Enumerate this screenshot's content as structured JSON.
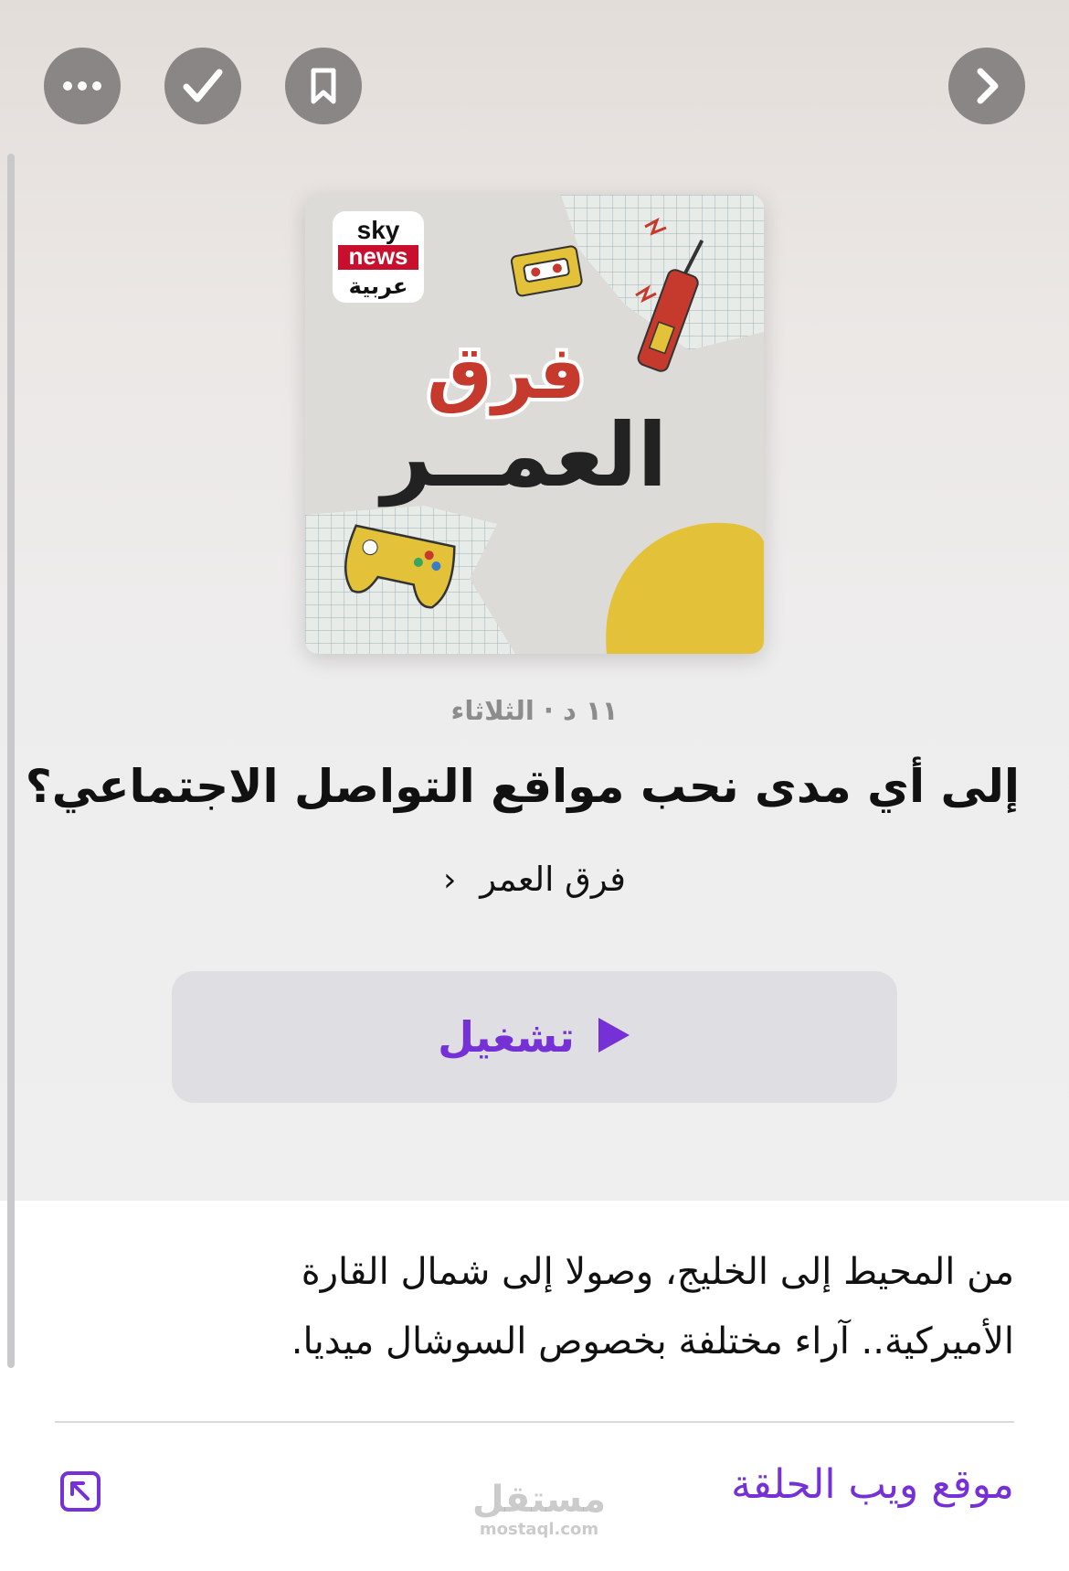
{
  "top_bar": {
    "more_icon": "ellipsis-icon",
    "played_icon": "checkmark-icon",
    "save_icon": "bookmark-icon",
    "next_icon": "chevron-right-icon"
  },
  "cover": {
    "brand_line1": "sky",
    "brand_line2": "news",
    "brand_line3": "عربية",
    "show_title_line1": "فرق",
    "show_title_line2": "العمــر"
  },
  "episode": {
    "meta": "١١ د · الثلاثاء",
    "title": "إلى أي مدى نحب مواقع التواصل الاجتماعي؟",
    "show_name": "فرق العمر",
    "show_chevron": "‹"
  },
  "play_button": {
    "label": "تشغيل",
    "color": "#7530d6"
  },
  "description": {
    "text": "من المحيط إلى الخليج، وصولا إلى شمال القارة الأميركية.. آراء مختلفة بخصوص السوشال ميديا."
  },
  "website": {
    "label": "موقع ويب الحلقة",
    "icon": "external-link-icon"
  },
  "watermark": {
    "arabic": "مستقل",
    "latin": "mostaql.com"
  }
}
